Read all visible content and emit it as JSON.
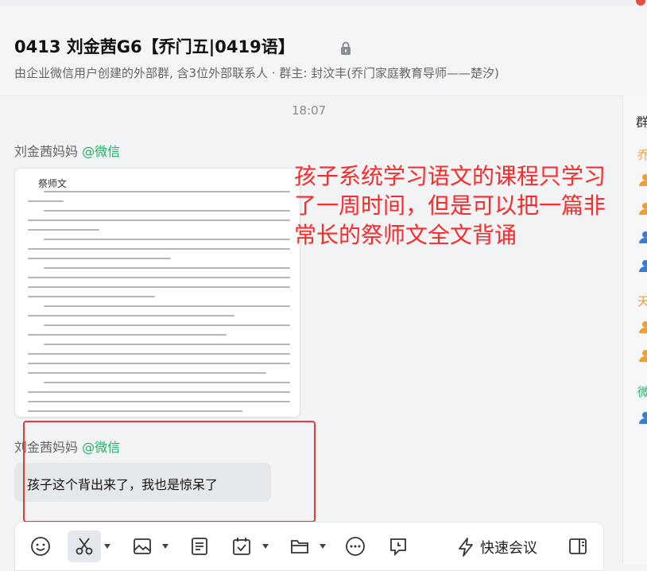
{
  "header": {
    "title": "0413 刘金茜G6【乔门五|0419语】",
    "subtitle": "由企业微信用户创建的外部群, 含3位外部联系人 · 群主: 封汶丰(乔门家庭教育导师——楚汐)"
  },
  "right_panel": {
    "heading": "群",
    "labels": [
      "乔",
      "天",
      "微"
    ]
  },
  "messages": {
    "time": "18:07",
    "msg1": {
      "sender": "刘金茜妈妈",
      "source": "@微信",
      "image_title": "祭师文"
    },
    "msg2": {
      "sender": "刘金茜妈妈",
      "source": "@微信",
      "text": "孩子这个背出来了，我也是惊呆了"
    }
  },
  "annotation": {
    "text": "孩子系统学习语文的课程只学习了一周时间，但是可以把一篇非常长的祭师文全文背诵",
    "color": "#ff2a2a"
  },
  "toolbar": {
    "quick_meeting_label": "快速会议",
    "icons": [
      "emoji-icon",
      "screenshot-icon",
      "image-icon",
      "document-icon",
      "schedule-icon",
      "folder-icon",
      "more-icon",
      "chat-icon",
      "lightning-icon",
      "panel-icon"
    ]
  },
  "colors": {
    "wechat_green": "#2aae67",
    "highlight_red": "#e53935",
    "avatar_orange": "#f0a030",
    "avatar_blue": "#3a7bd5"
  }
}
